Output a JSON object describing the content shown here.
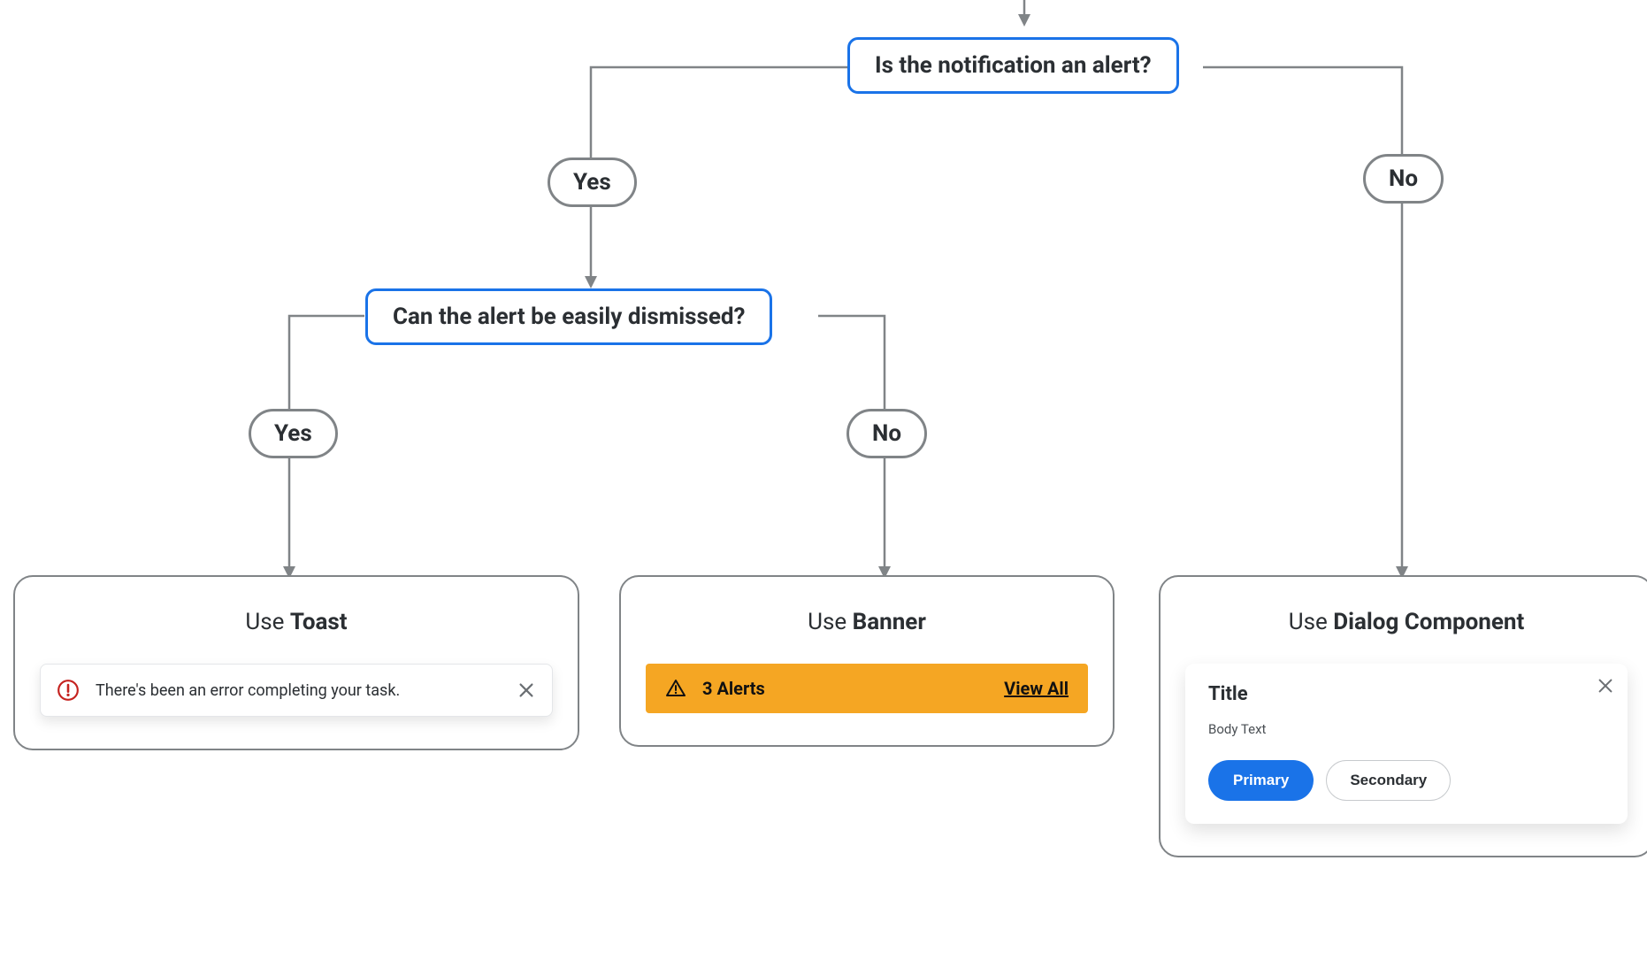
{
  "q1": "Is the notification an alert?",
  "q1_yes": "Yes",
  "q1_no": "No",
  "q2": "Can the alert be easily dismissed?",
  "q2_yes": "Yes",
  "q2_no": "No",
  "leaf_toast": {
    "use": "Use ",
    "name": "Toast"
  },
  "leaf_banner": {
    "use": "Use ",
    "name": "Banner"
  },
  "leaf_dialog": {
    "use": "Use ",
    "name": "Dialog Component"
  },
  "toast": {
    "message": "There's been an error completing your task."
  },
  "banner": {
    "text": "3 Alerts",
    "link": "View All"
  },
  "dialog": {
    "title": "Title",
    "body": "Body Text",
    "primary": "Primary",
    "secondary": "Secondary"
  },
  "colors": {
    "accent": "#1a73e8",
    "warning": "#f5a623",
    "error": "#c5221f"
  }
}
